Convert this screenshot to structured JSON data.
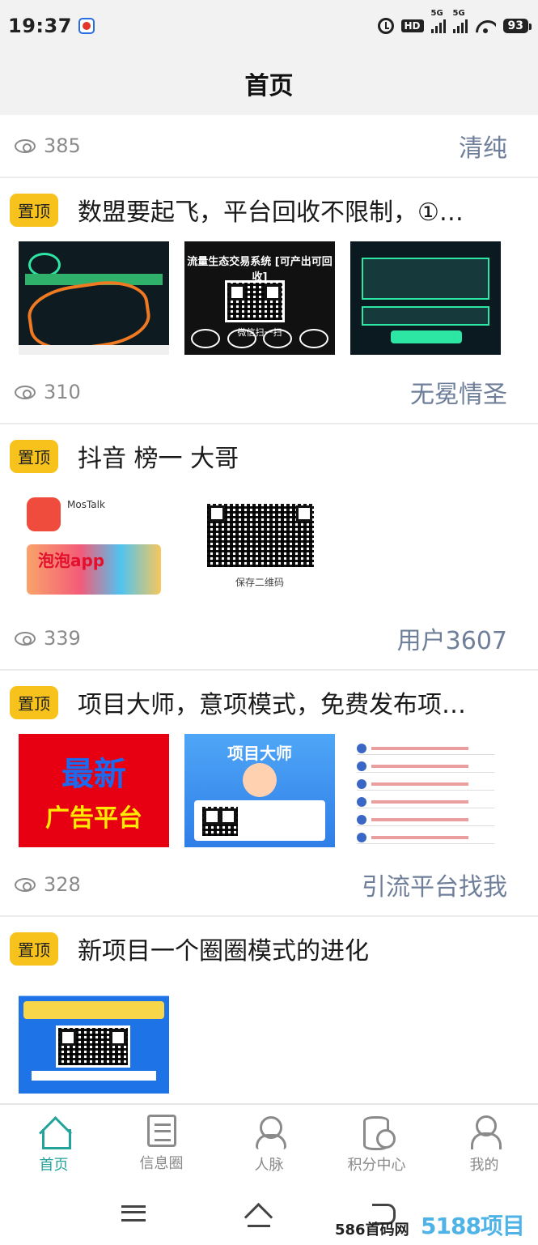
{
  "status_bar": {
    "time": "19:37",
    "hd": "HD",
    "signal1": "5G",
    "signal2": "5G",
    "battery": "93"
  },
  "header": {
    "title": "首页"
  },
  "feed": {
    "top_partial": {
      "views": "385",
      "author": "清纯"
    },
    "posts": [
      {
        "badge": "置顶",
        "title": "数盟要起飞，平台回收不限制，①…",
        "views": "310",
        "author": "无冕情圣",
        "images": [
          "流量生态交易系统 [可产出可回收]",
          "微信扫一扫"
        ]
      },
      {
        "badge": "置顶",
        "title": "抖音 榜一 大哥",
        "views": "339",
        "author": "用户3607",
        "images": [
          "MosTalk",
          "泡泡app",
          "保存二维码"
        ]
      },
      {
        "badge": "置顶",
        "title": "项目大师，意项模式，免费发布项…",
        "views": "328",
        "author": "引流平台找我",
        "images": [
          "最新",
          "广告平台",
          "项目大师"
        ]
      },
      {
        "badge": "置顶",
        "title": "新项目一个圈圈模式的进化",
        "views": "",
        "author": "",
        "images": []
      }
    ]
  },
  "tabbar": {
    "tabs": [
      {
        "label": "首页",
        "icon": "home-icon",
        "active": true
      },
      {
        "label": "信息圈",
        "icon": "list-icon",
        "active": false
      },
      {
        "label": "人脉",
        "icon": "people-icon",
        "active": false
      },
      {
        "label": "积分中心",
        "icon": "coin-icon",
        "active": false
      },
      {
        "label": "我的",
        "icon": "user-icon",
        "active": false
      }
    ]
  },
  "watermark": {
    "text": "586首码网",
    "logo": "5188项目网"
  },
  "colors": {
    "accent": "#24a39a",
    "badge": "#f7c21b",
    "author": "#6f7f9a"
  }
}
